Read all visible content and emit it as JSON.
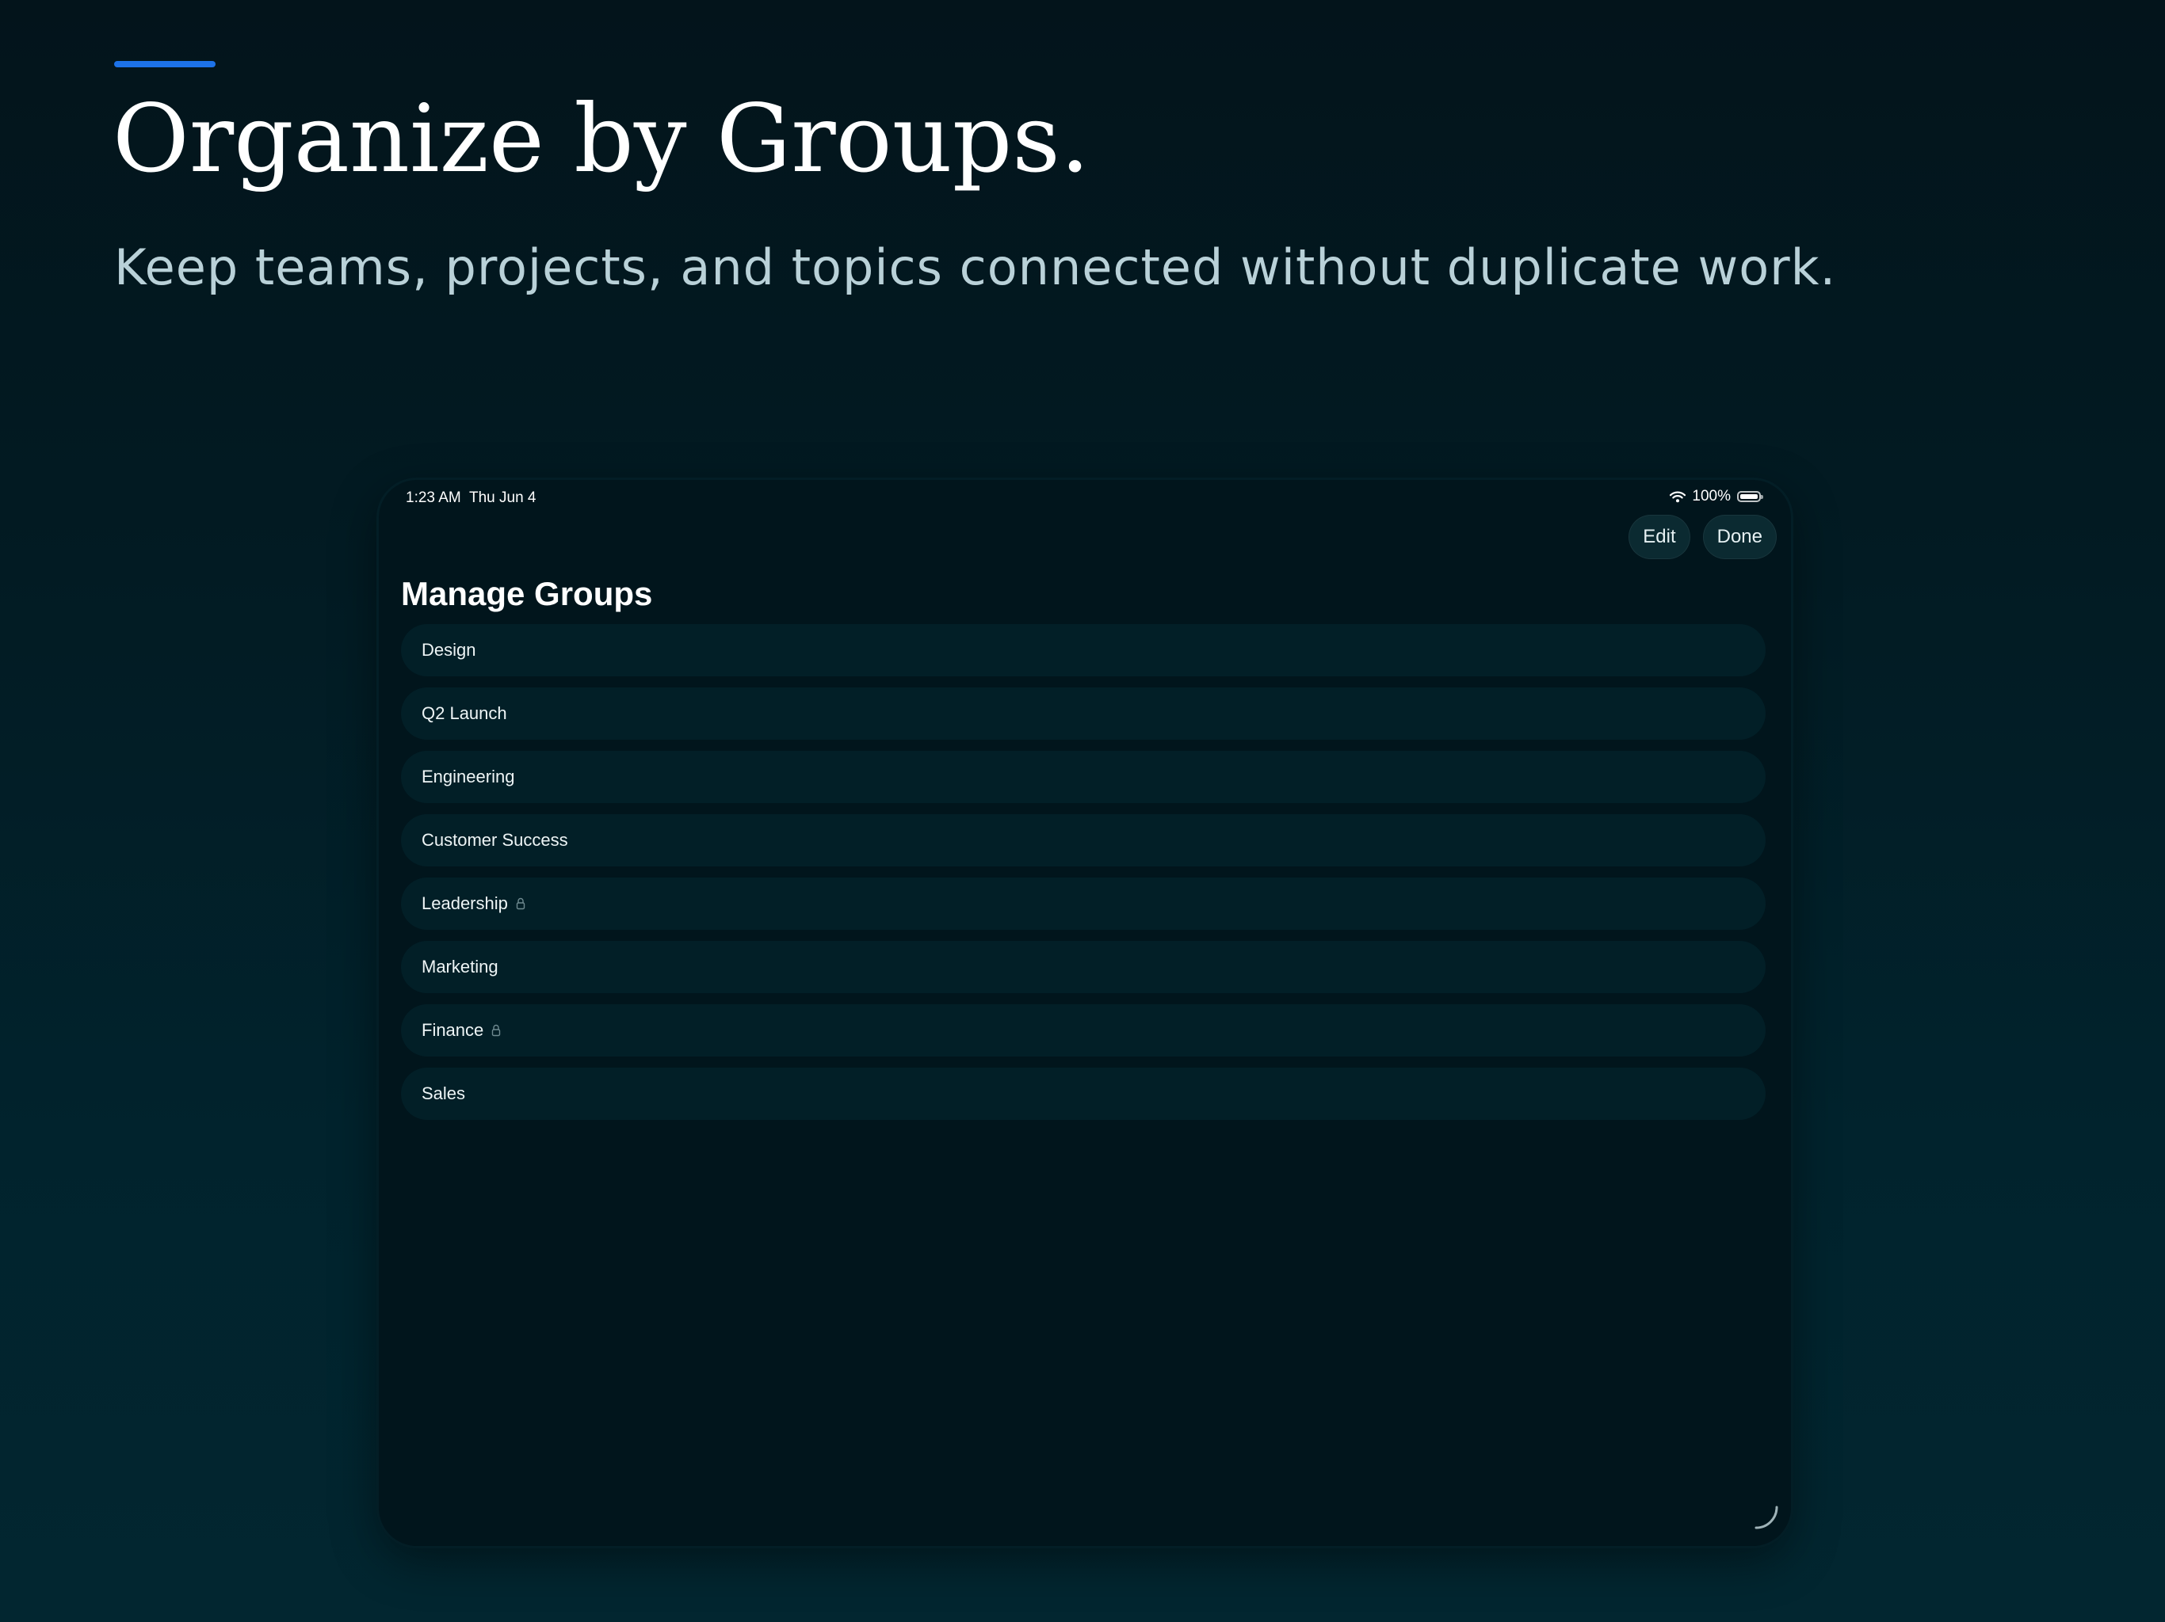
{
  "hero": {
    "headline": "Organize by Groups.",
    "subhead": "Keep teams, projects, and topics connected without duplicate work."
  },
  "status_bar": {
    "time": "1:23 AM",
    "date": "Thu Jun 4",
    "battery_level": "100%"
  },
  "nav": {
    "edit_label": "Edit",
    "done_label": "Done"
  },
  "page": {
    "title": "Manage Groups"
  },
  "groups": [
    {
      "label": "Design",
      "locked": false
    },
    {
      "label": "Q2 Launch",
      "locked": false
    },
    {
      "label": "Engineering",
      "locked": false
    },
    {
      "label": "Customer Success",
      "locked": false
    },
    {
      "label": "Leadership",
      "locked": true
    },
    {
      "label": "Marketing",
      "locked": false
    },
    {
      "label": "Finance",
      "locked": true
    },
    {
      "label": "Sales",
      "locked": false
    }
  ],
  "colors": {
    "accent": "#1d72e8",
    "background_top": "#03141b",
    "background_bottom": "#022630",
    "device_bg": "#01151c",
    "row_bg": "#021f27",
    "button_bg": "#0b2a31"
  }
}
